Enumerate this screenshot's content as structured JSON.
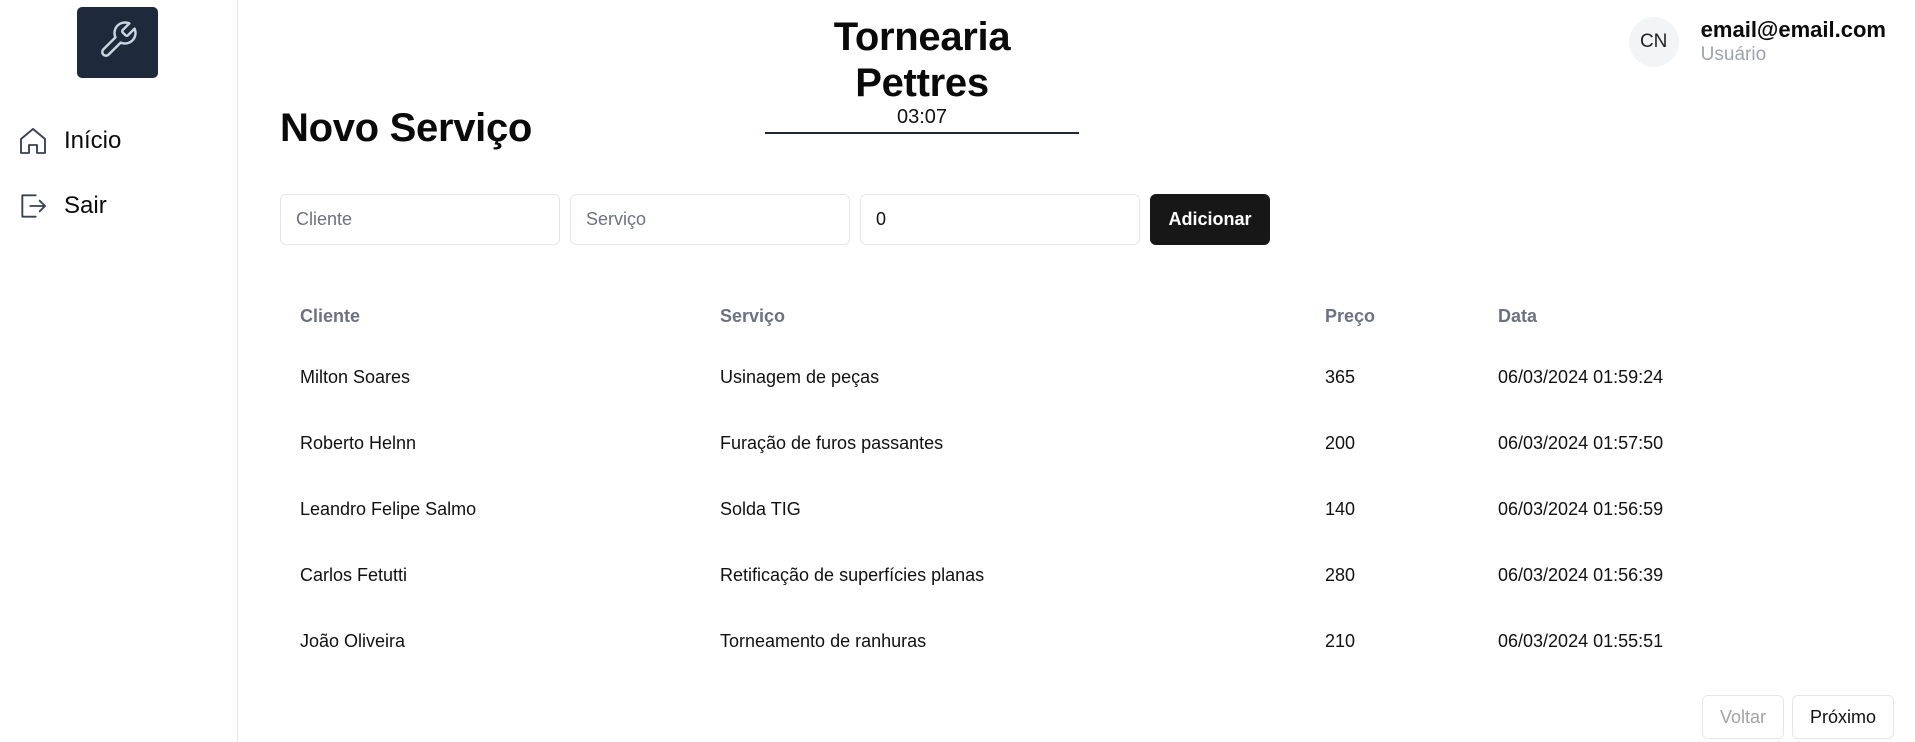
{
  "header": {
    "title": "Tornearia Pettres",
    "clock": "03:07"
  },
  "user": {
    "initials": "CN",
    "email": "email@email.com",
    "role": "Usuário"
  },
  "sidebar": {
    "logo_icon": "wrench-icon",
    "items": [
      {
        "label": "Início",
        "icon": "home-icon"
      },
      {
        "label": "Sair",
        "icon": "logout-icon"
      }
    ]
  },
  "main": {
    "title": "Novo Serviço",
    "form": {
      "cliente_placeholder": "Cliente",
      "servico_placeholder": "Serviço",
      "preco_value": "0",
      "add_label": "Adicionar"
    },
    "table": {
      "headers": [
        "Cliente",
        "Serviço",
        "Preço",
        "Data"
      ],
      "rows": [
        [
          "Milton Soares",
          "Usinagem de peças",
          "365",
          "06/03/2024 01:59:24"
        ],
        [
          "Roberto Helnn",
          "Furação de furos passantes",
          "200",
          "06/03/2024 01:57:50"
        ],
        [
          "Leandro Felipe Salmo",
          "Solda TIG",
          "140",
          "06/03/2024 01:56:59"
        ],
        [
          "Carlos Fetutti",
          "Retificação de superfícies planas",
          "280",
          "06/03/2024 01:56:39"
        ],
        [
          "João Oliveira",
          "Torneamento de ranhuras",
          "210",
          "06/03/2024 01:55:51"
        ]
      ]
    },
    "pagination": {
      "prev_label": "Voltar",
      "next_label": "Próximo"
    }
  },
  "colors": {
    "logo_bg": "#1e293b",
    "primary_button": "#171717",
    "muted_text": "#6b7280"
  }
}
